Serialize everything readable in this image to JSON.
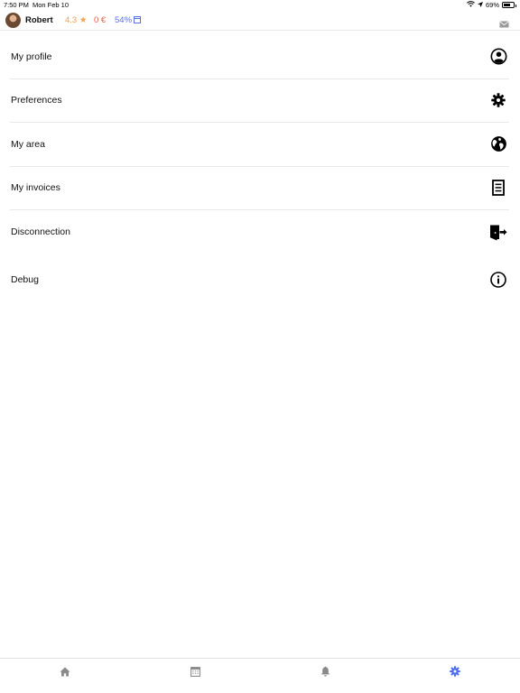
{
  "status_bar": {
    "time": "7:50 PM",
    "date": "Mon Feb 10",
    "battery_percent": "69%",
    "battery_level": 0.69
  },
  "header": {
    "username": "Robert",
    "rating": "4.3",
    "rating_icon": "star-icon",
    "money": "0 €",
    "percent": "54%",
    "percent_icon": "calendar-icon",
    "mail_icon": "envelope-icon"
  },
  "menu": {
    "items": [
      {
        "label": "My profile",
        "icon": "user-circle-icon"
      },
      {
        "label": "Preferences",
        "icon": "gear-icon"
      },
      {
        "label": "My area",
        "icon": "globe-icon"
      },
      {
        "label": "My invoices",
        "icon": "invoice-icon"
      },
      {
        "label": "Disconnection",
        "icon": "exit-door-icon"
      },
      {
        "label": "Debug",
        "icon": "info-icon"
      }
    ]
  },
  "tab_bar": {
    "tabs": [
      {
        "icon": "home-icon",
        "active": false
      },
      {
        "icon": "calendar-icon",
        "active": false
      },
      {
        "icon": "bell-icon",
        "active": false
      },
      {
        "icon": "gear-icon",
        "active": true
      }
    ]
  },
  "colors": {
    "rating": "#f0a050",
    "money": "#e8594a",
    "percent": "#5b6ee8",
    "active_tab": "#4a6cf0",
    "inactive_tab": "#8a8a8a",
    "divider": "#e8e8e8"
  }
}
